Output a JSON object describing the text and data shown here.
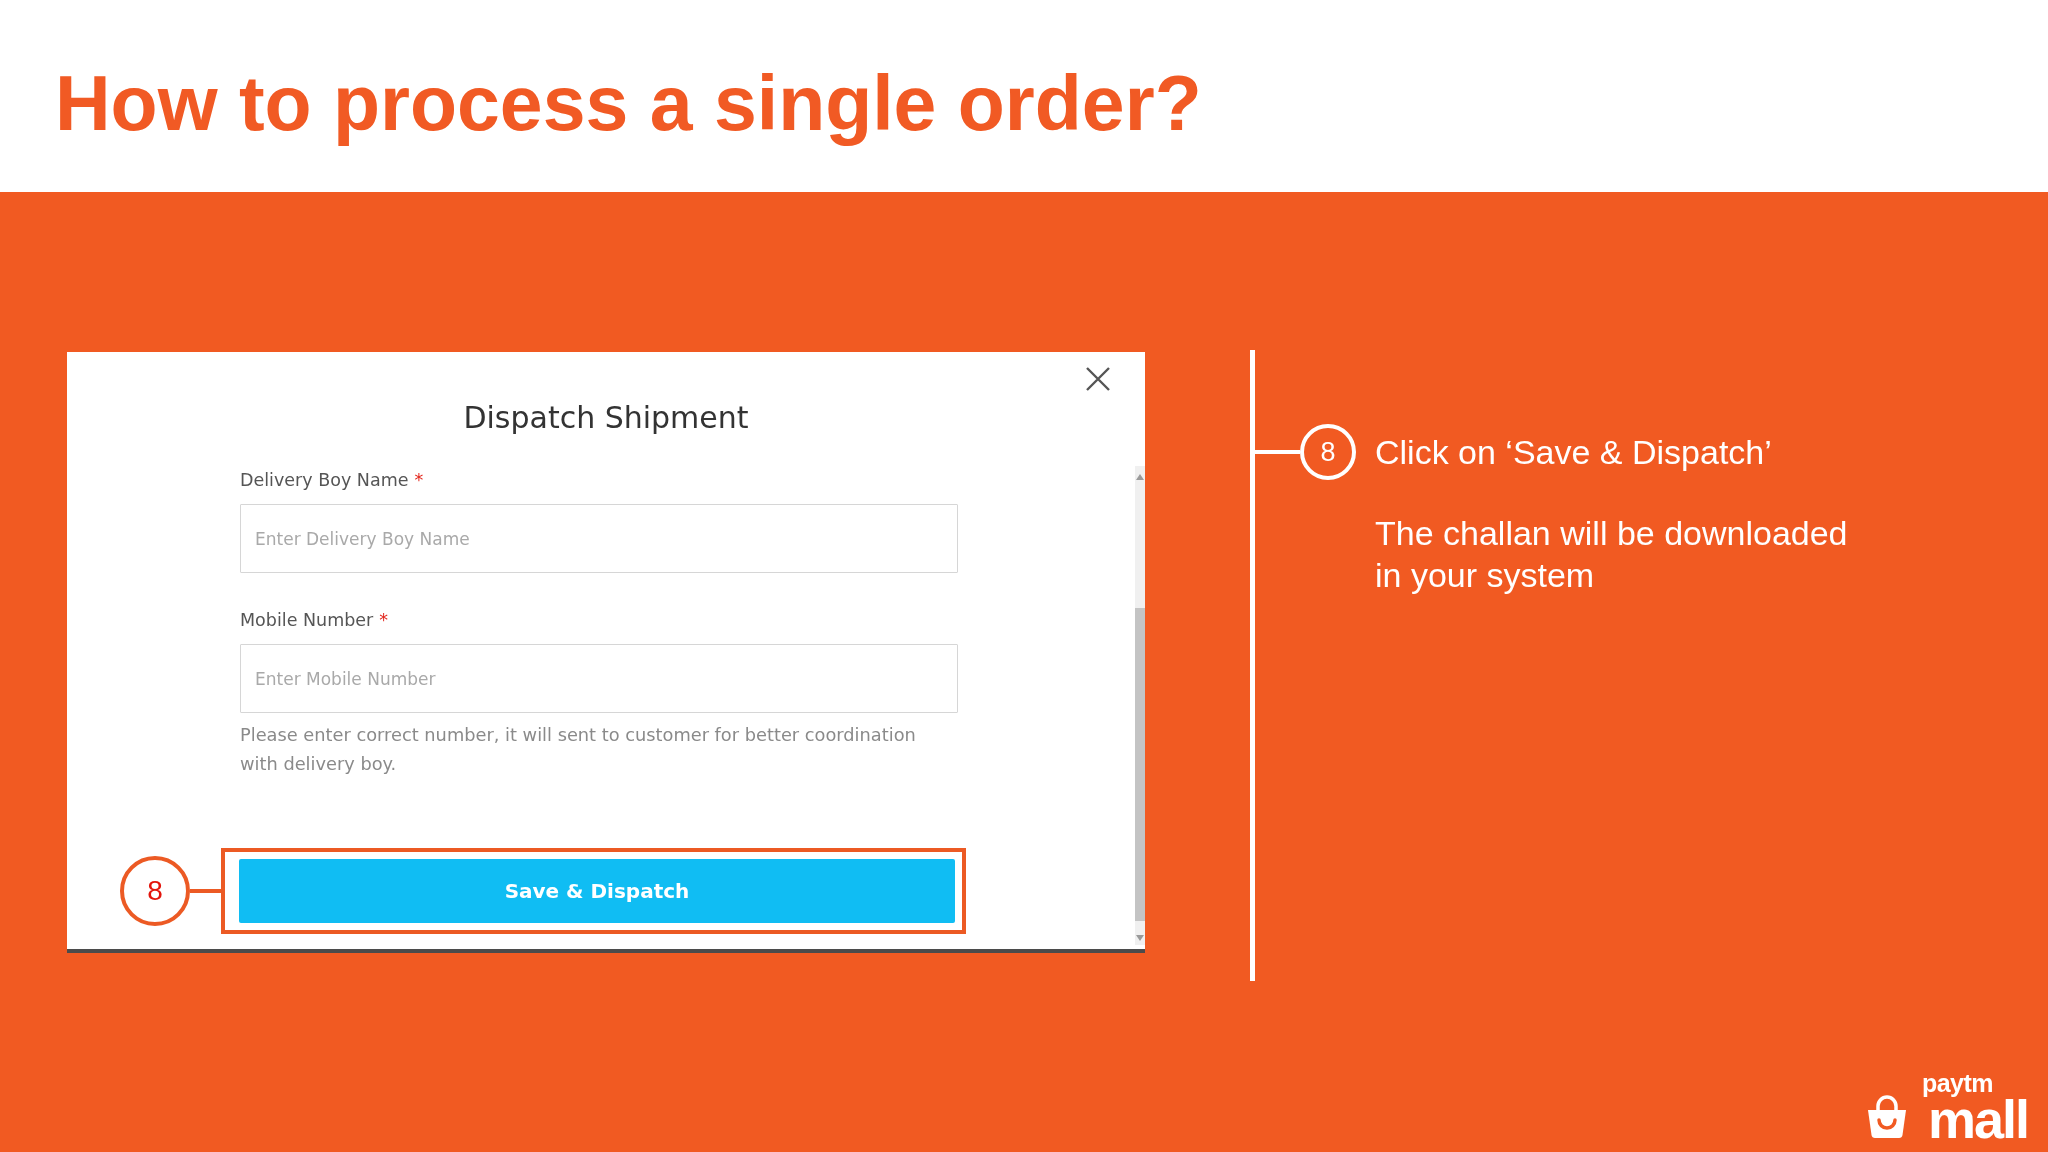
{
  "slide": {
    "title": "How to process a single order?"
  },
  "dialog": {
    "title": "Dispatch Shipment",
    "fields": [
      {
        "label": "Delivery Boy Name",
        "required_mark": "*",
        "placeholder": "Enter Delivery Boy Name"
      },
      {
        "label": "Mobile Number",
        "required_mark": "*",
        "placeholder": "Enter Mobile Number",
        "hint": "Please enter correct number, it will sent to customer for better coordination with delivery boy."
      }
    ],
    "callout": "8",
    "button": "Save & Dispatch"
  },
  "step": {
    "number": "8",
    "instruction": "Click on ‘Save & Dispatch’",
    "note": "The challan will be downloaded in your system"
  },
  "logo": {
    "top": "paytm",
    "bottom": "mall"
  }
}
